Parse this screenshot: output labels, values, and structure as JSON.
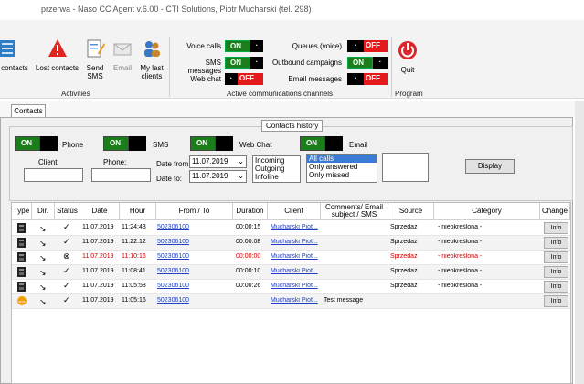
{
  "window": {
    "title": "przerwa - Naso CC Agent v.6.00 - CTI Solutions, Piotr Mucharski (tel. 298)"
  },
  "ribbon": {
    "activities": {
      "group_label": "Activities",
      "buttons": [
        {
          "label": "contacts",
          "icon": "contacts-icon"
        },
        {
          "label": "Lost contacts",
          "icon": "warning-icon"
        },
        {
          "label": "Send\nSMS",
          "icon": "sms-edit-icon"
        },
        {
          "label": "Email",
          "icon": "envelope-icon"
        },
        {
          "label": "My last\nclients",
          "icon": "users-icon"
        }
      ]
    },
    "channels": {
      "group_label": "Active communications channels",
      "left": [
        {
          "label": "Voice calls",
          "state": "ON"
        },
        {
          "label": "SMS messages",
          "state": "ON"
        },
        {
          "label": "Web chat",
          "state": "OFF"
        }
      ],
      "right": [
        {
          "label": "Queues (voice)",
          "state": "OFF"
        },
        {
          "label": "Outbound campaigns",
          "state": "ON"
        },
        {
          "label": "Email messages",
          "state": "OFF"
        }
      ],
      "on_text": "ON",
      "off_text": "OFF"
    },
    "program": {
      "group_label": "Program",
      "quit_label": "Quit"
    }
  },
  "tabs": {
    "contacts": "Contacts"
  },
  "history": {
    "label": "Contacts history",
    "toggles": [
      {
        "label": "Phone",
        "state": "ON"
      },
      {
        "label": "SMS",
        "state": "ON"
      },
      {
        "label": "Web Chat",
        "state": "ON"
      },
      {
        "label": "Email",
        "state": "ON"
      }
    ],
    "client_label": "Client:",
    "phone_label": "Phone:",
    "client_value": "",
    "phone_value": "",
    "date_from_label": "Date from:",
    "date_to_label": "Date to:",
    "date_from": "11.07.2019",
    "date_to": "11.07.2019",
    "channel_options": [
      "Incoming",
      "Outgoing",
      "Infoline"
    ],
    "call_options": [
      "All calls",
      "Only answered",
      "Only missed"
    ],
    "call_selected": "All calls",
    "display_button": "Display"
  },
  "table": {
    "headers": [
      "Type",
      "Dir.",
      "Status",
      "Date",
      "Hour",
      "From / To",
      "Duration",
      "Client",
      "Comments/ Email subject / SMS",
      "Source",
      "Category",
      "Change"
    ],
    "rows": [
      {
        "type": "phone",
        "dir": "↘",
        "status": "✓",
        "date": "11.07.2019",
        "hour": "11:24:43",
        "from": "502306100",
        "duration": "00:00:15",
        "client": "Mucharski Piot...",
        "comment": "",
        "source": "Sprzedaż",
        "category": "- nieokreślona -",
        "change": "Info",
        "missed": false
      },
      {
        "type": "phone",
        "dir": "↘",
        "status": "✓",
        "date": "11.07.2019",
        "hour": "11:22:12",
        "from": "502306100",
        "duration": "00:00:08",
        "client": "Mucharski Piot...",
        "comment": "",
        "source": "Sprzedaż",
        "category": "- nieokreślona -",
        "change": "Info",
        "missed": false
      },
      {
        "type": "phone",
        "dir": "↘",
        "status": "⊗",
        "date": "11.07.2019",
        "hour": "11:10:16",
        "from": "502306100",
        "duration": "00:00:00",
        "client": "Mucharski Piot...",
        "comment": "",
        "source": "Sprzedaż",
        "category": "- nieokreślona -",
        "change": "Info",
        "missed": true
      },
      {
        "type": "phone",
        "dir": "↘",
        "status": "✓",
        "date": "11.07.2019",
        "hour": "11:08:41",
        "from": "502306100",
        "duration": "00:00:10",
        "client": "Mucharski Piot...",
        "comment": "",
        "source": "Sprzedaż",
        "category": "- nieokreślona -",
        "change": "Info",
        "missed": false
      },
      {
        "type": "phone",
        "dir": "↘",
        "status": "✓",
        "date": "11.07.2019",
        "hour": "11:05:58",
        "from": "502306100",
        "duration": "00:00:26",
        "client": "Mucharski Piot...",
        "comment": "",
        "source": "Sprzedaż",
        "category": "- nieokreślona -",
        "change": "Info",
        "missed": false
      },
      {
        "type": "sms",
        "dir": "↘",
        "status": "✓",
        "date": "11.07.2019",
        "hour": "11:05:16",
        "from": "502306100",
        "duration": "",
        "client": "Mucharski Piot...",
        "comment": "Test message",
        "source": "",
        "category": "",
        "change": "Info",
        "missed": false
      }
    ]
  },
  "colors": {
    "on": "#1a7f1a",
    "off": "#e41a1a",
    "link": "#1f3fbf",
    "missed": "#d00000"
  }
}
